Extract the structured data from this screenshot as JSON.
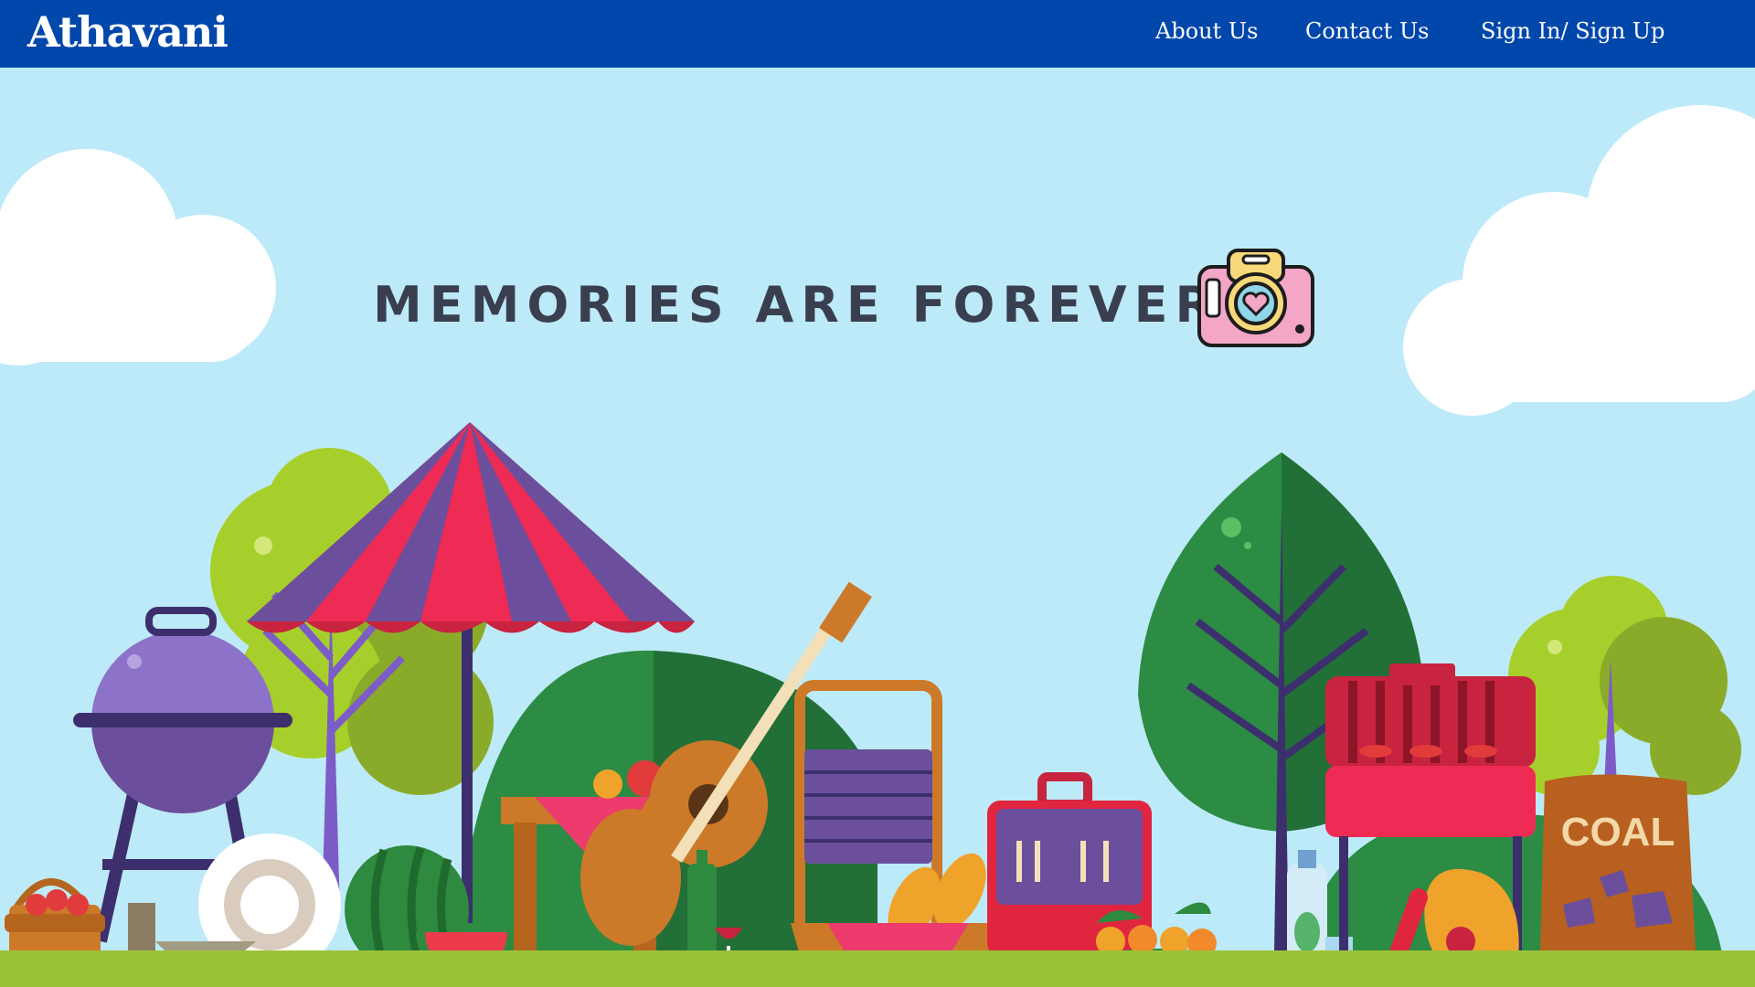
{
  "nav": {
    "brand": "Athavani",
    "links": [
      "About Us",
      "Contact Us",
      "Sign In/ Sign Up"
    ]
  },
  "hero": {
    "headline": "MEMORIES ARE FOREVER",
    "camera_icon": "camera-heart-icon"
  },
  "illustration": {
    "coal_bag_label": "COAL"
  },
  "colors": {
    "nav_background": "#0047ab",
    "sky": "#bdeaf9",
    "headline_text": "#3a3f4f",
    "grass": "#9cc23a"
  }
}
